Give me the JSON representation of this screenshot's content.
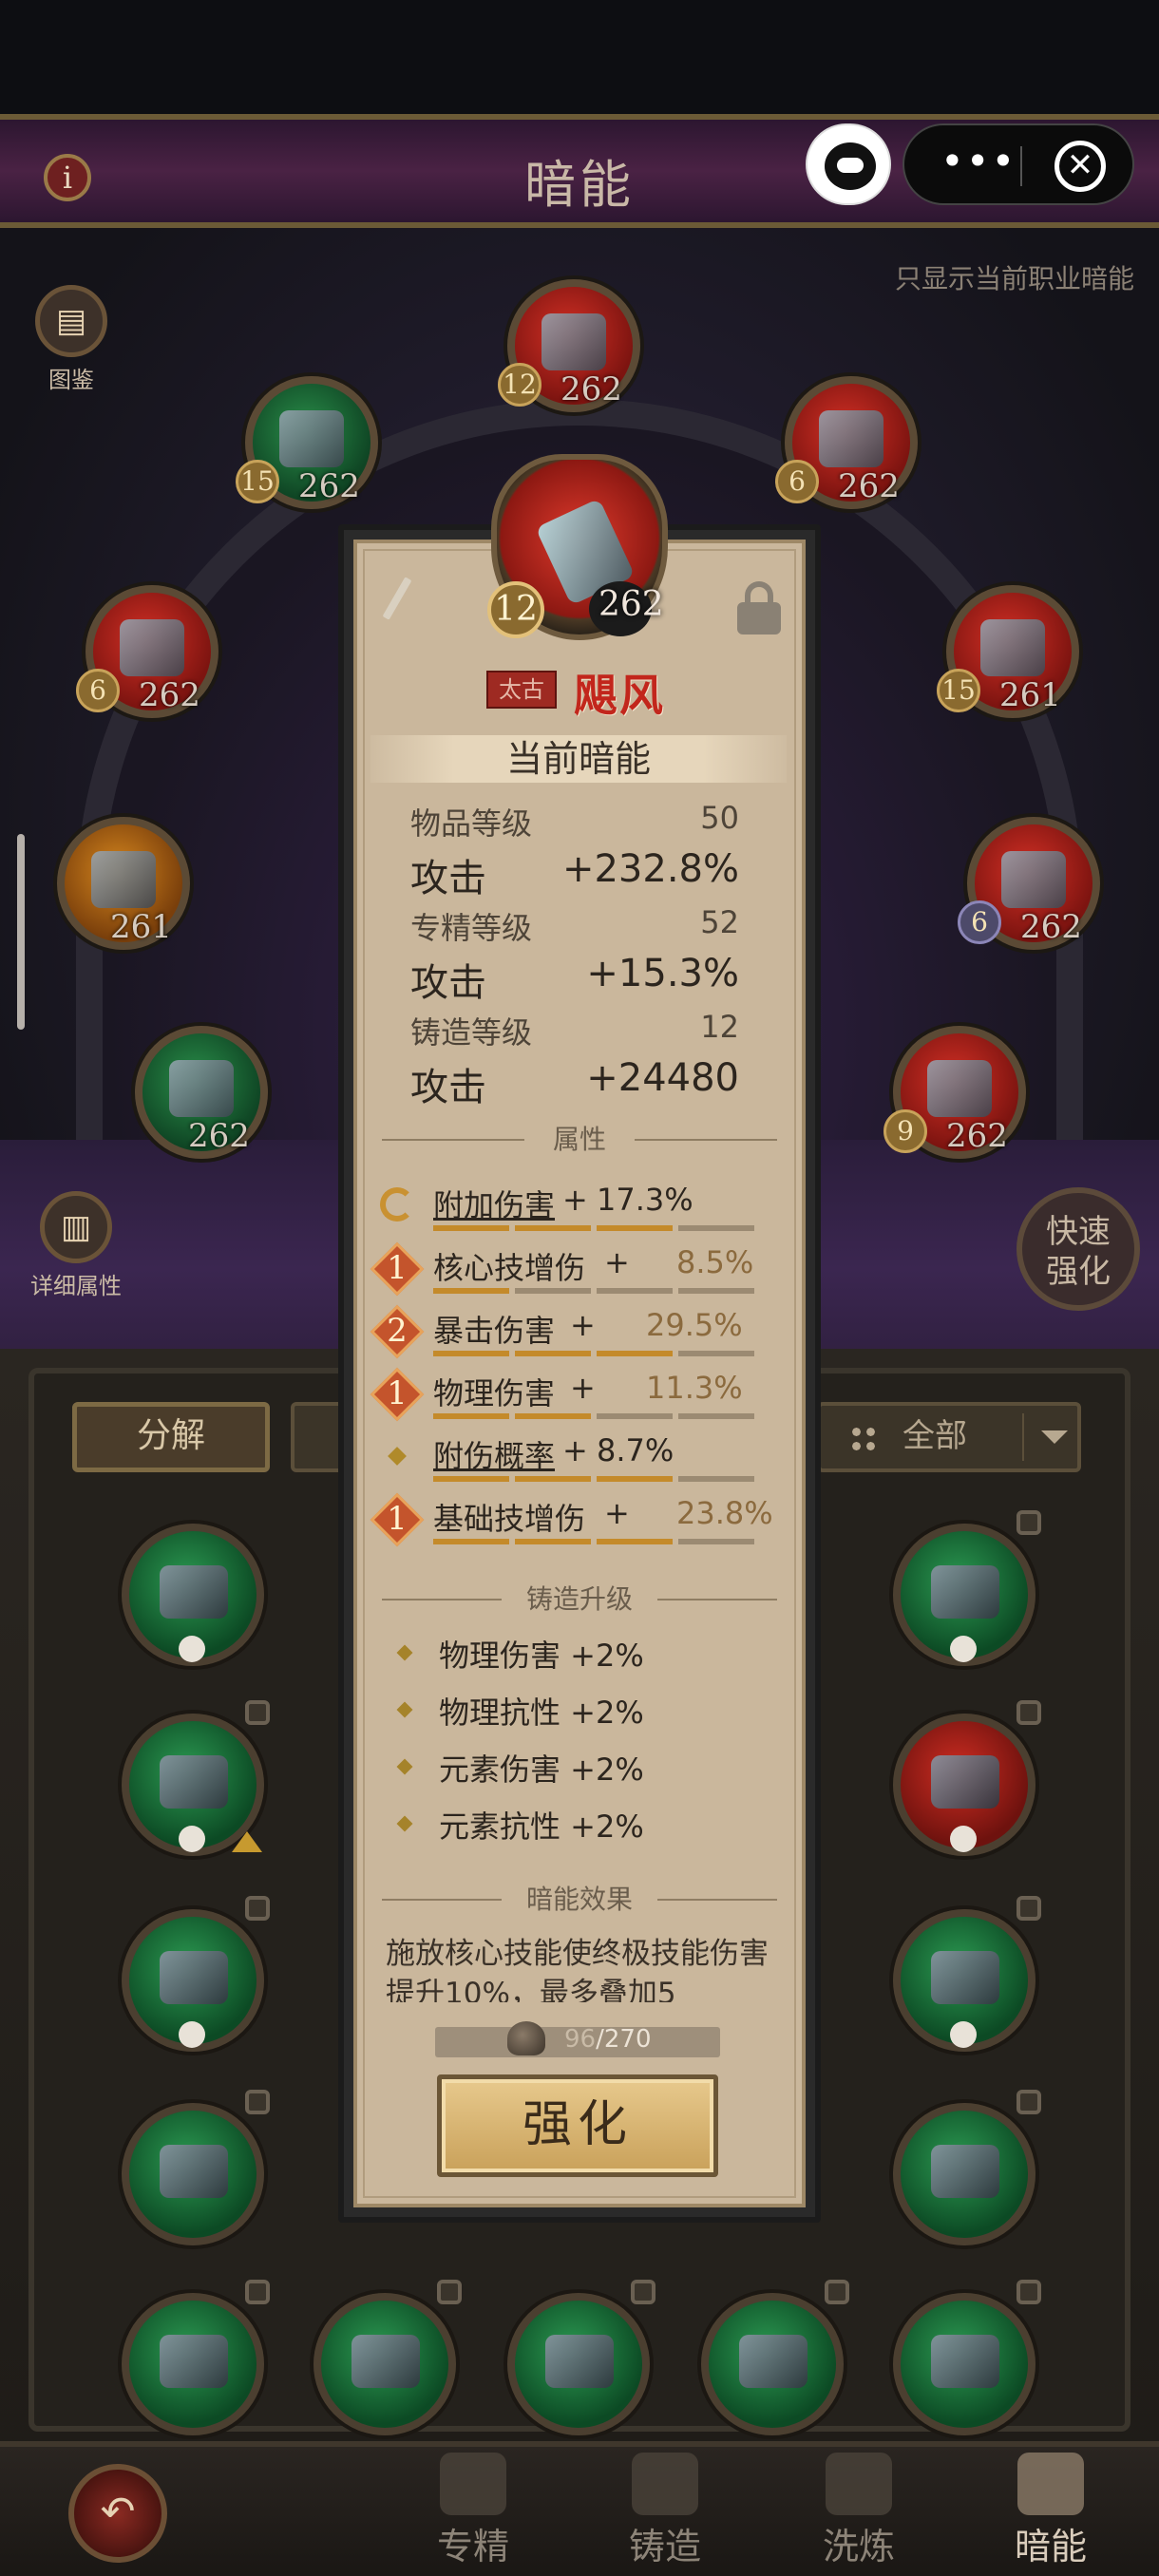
{
  "header": {
    "title": "暗能"
  },
  "only_current_label": "只显示当前职业暗能",
  "side": {
    "codex_label": "图鉴",
    "detail_label": "详细属性",
    "quick_label_1": "快速",
    "quick_label_2": "强化"
  },
  "nodes": [
    {
      "level": "12",
      "power": "262",
      "color": "red"
    },
    {
      "level": "15",
      "power": "262",
      "color": "green"
    },
    {
      "level": "6",
      "power": "262",
      "color": "red"
    },
    {
      "level": "6",
      "power": "262",
      "color": "red"
    },
    {
      "level": "15",
      "power": "261",
      "color": "red"
    },
    {
      "level": "",
      "power": "261",
      "color": "orange"
    },
    {
      "level": "6",
      "power": "262",
      "color": "red"
    },
    {
      "level": "",
      "power": "262",
      "color": "green"
    },
    {
      "level": "9",
      "power": "262",
      "color": "red"
    }
  ],
  "inventory": {
    "decompose_label": "分解",
    "filter_label": "全部"
  },
  "card": {
    "level": "12",
    "power": "262",
    "rarity": "太古",
    "item_name": "飓风",
    "current_section": "当前暗能",
    "stats": [
      {
        "label": "物品等级",
        "value": "50"
      },
      {
        "label": "攻击",
        "value": "+232.8%"
      },
      {
        "label": "专精等级",
        "value": "52"
      },
      {
        "label": "攻击",
        "value": "+15.3%"
      },
      {
        "label": "铸造等级",
        "value": "12"
      },
      {
        "label": "攻击",
        "value": "+24480"
      }
    ],
    "attr_section": "属性",
    "attributes": [
      {
        "badge": "",
        "name": "附加伤害",
        "plus": "+",
        "value": "17.3%"
      },
      {
        "badge": "1",
        "name": "核心技增伤",
        "plus": "+",
        "value": "8.5%"
      },
      {
        "badge": "2",
        "name": "暴击伤害",
        "plus": "+",
        "value": "29.5%"
      },
      {
        "badge": "1",
        "name": "物理伤害",
        "plus": "+",
        "value": "11.3%"
      },
      {
        "badge": "",
        "name": "附伤概率",
        "plus": "+",
        "value": "8.7%"
      },
      {
        "badge": "1",
        "name": "基础技增伤",
        "plus": "+",
        "value": "23.8%"
      }
    ],
    "forge_section": "铸造升级",
    "forge": [
      "物理伤害 +2%",
      "物理抗性 +2%",
      "元素伤害 +2%",
      "元素抗性 +2%"
    ],
    "effect_section": "暗能效果",
    "effect_text": "施放核心技能使终极技能伤害提升10%，最多叠加5",
    "material": {
      "current": "96",
      "total": "/270"
    },
    "strengthen_label": "强化"
  },
  "nav": {
    "tabs": [
      "专精",
      "铸造",
      "洗炼",
      "暗能"
    ],
    "active": "暗能"
  }
}
